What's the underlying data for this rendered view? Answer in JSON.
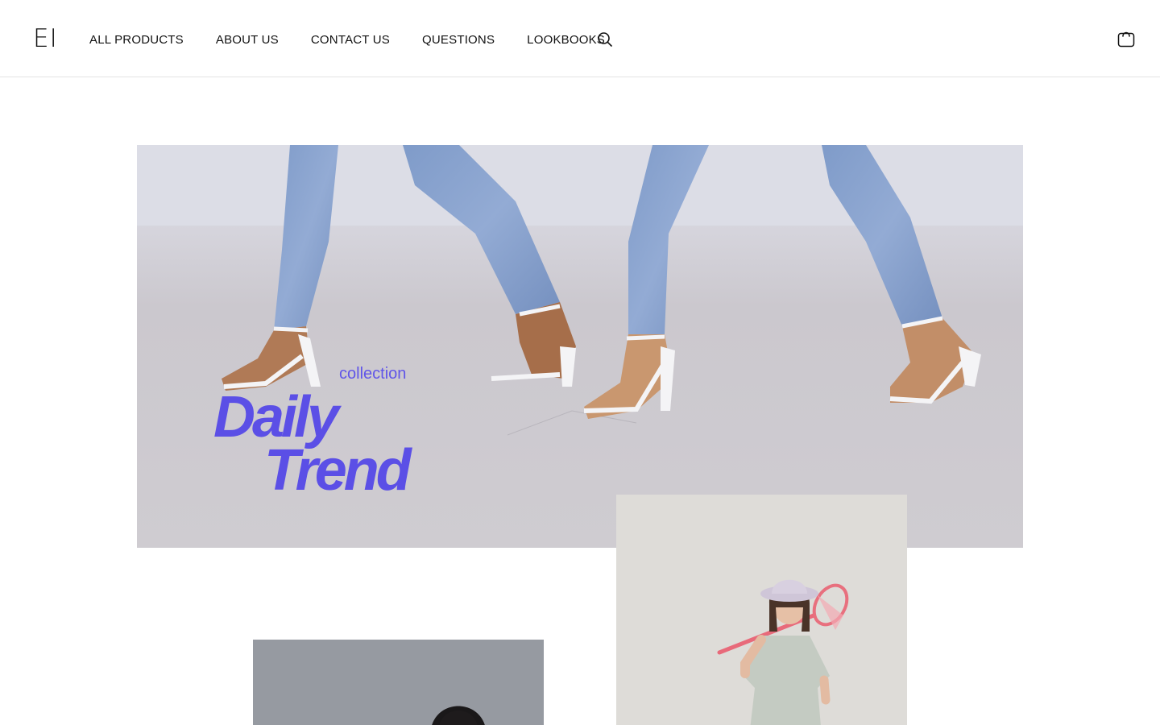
{
  "header": {
    "logo": "EI",
    "nav": [
      {
        "label": "ALL PRODUCTS"
      },
      {
        "label": "ABOUT US"
      },
      {
        "label": "CONTACT US"
      },
      {
        "label": "QUESTIONS"
      },
      {
        "label": "LOOKBOOKS"
      }
    ],
    "search_icon": "search-icon",
    "cart_icon": "shopping-bag-icon"
  },
  "hero": {
    "label": "collection",
    "title_line1": "Daily",
    "title_line2": "Trend",
    "accent_color": "#5b4fe6"
  }
}
